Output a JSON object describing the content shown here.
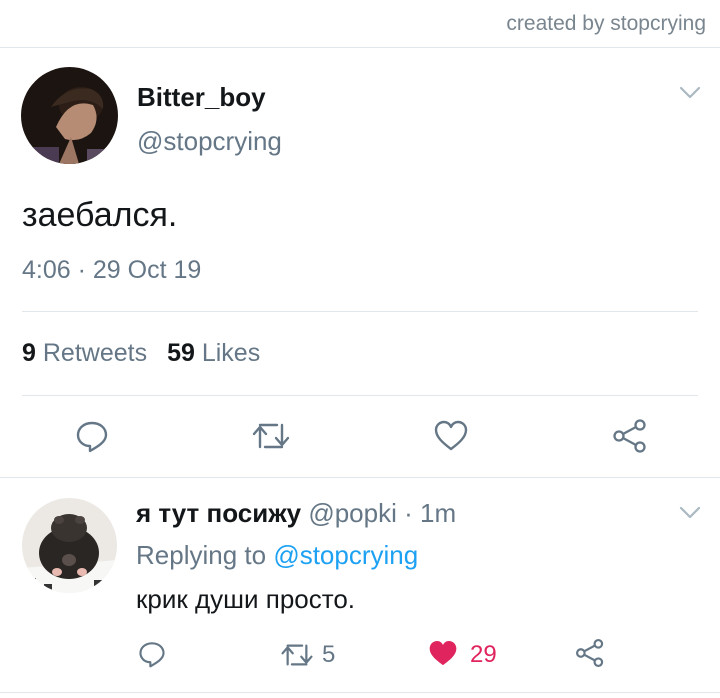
{
  "header": {
    "credit": "created by stopcrying"
  },
  "tweet": {
    "author_name": "Bitter_boy",
    "author_handle": "@stopcrying",
    "text": "заебался.",
    "timestamp": "4:06 · 29 Oct 19",
    "stats": {
      "retweets_count": "9",
      "retweets_label": "Retweets",
      "likes_count": "59",
      "likes_label": "Likes"
    },
    "actions": [
      "reply-icon",
      "retweet-icon",
      "like-icon",
      "share-icon"
    ]
  },
  "reply": {
    "author_name": "я тут посижу",
    "author_handle": "@popki",
    "separator": "·",
    "time": "1m",
    "replying_prefix": "Replying to",
    "replying_mention": "@stopcrying",
    "text": "крик души просто.",
    "retweet_count": "5",
    "like_count": "29",
    "liked": true
  },
  "colors": {
    "accent": "#1da1f2",
    "secondary_text": "#657786",
    "like_active": "#e0245e",
    "divider": "#e1e8ed"
  }
}
